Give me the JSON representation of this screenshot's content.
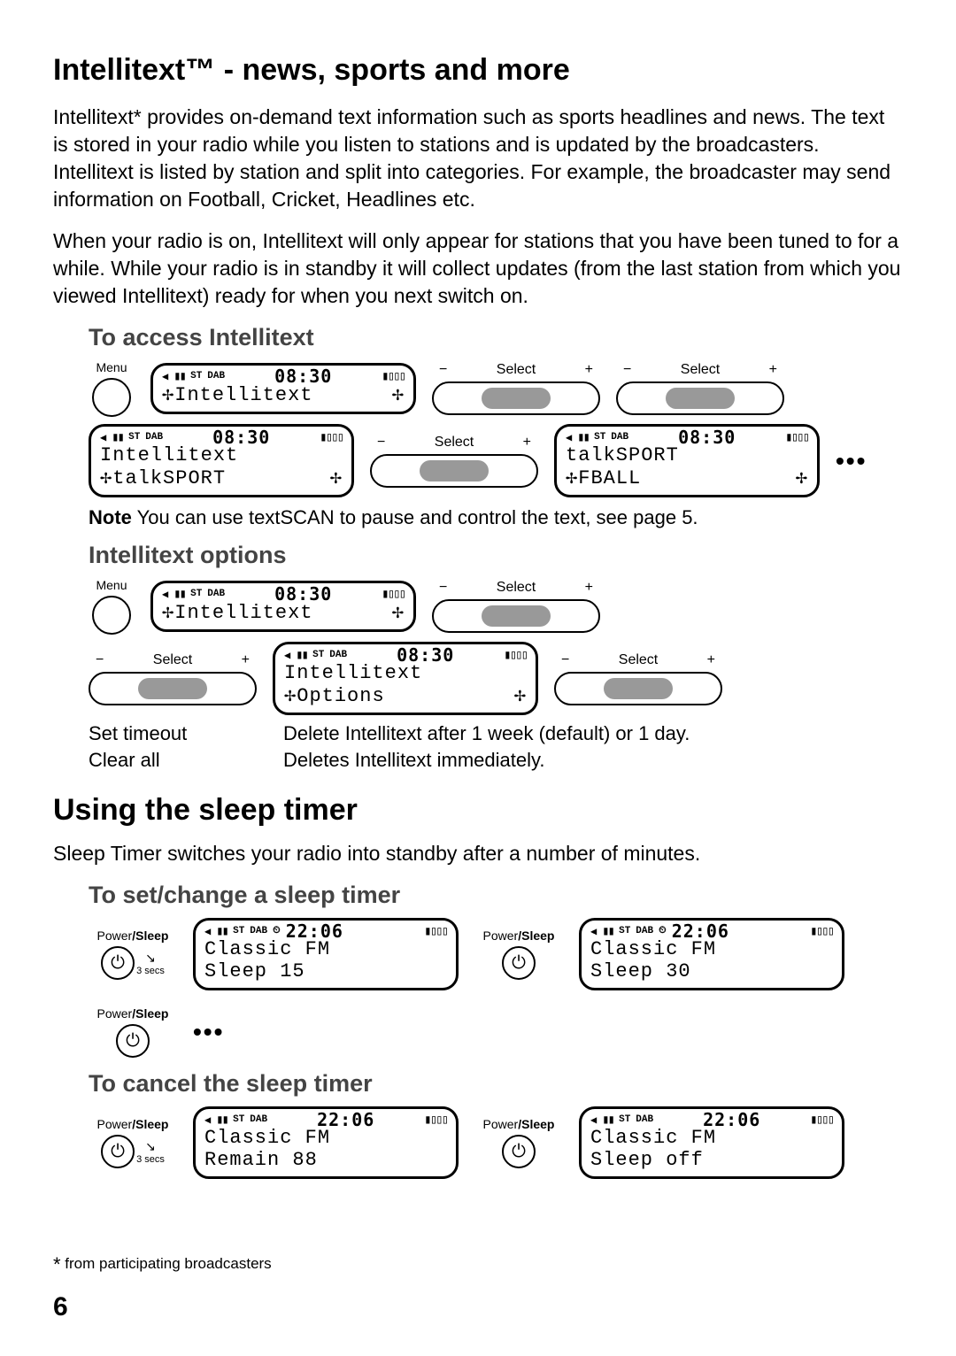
{
  "h1": "Intellitext™ - news, sports and more",
  "p1": "Intellitext* provides on-demand text information such as sports headlines and news. The text is stored in your radio while you listen to stations and is updated by the broadcasters. Intellitext is listed by station and split into categories. For example, the broadcaster may send information on Football, Cricket, Headlines etc.",
  "p2": "When your radio is on, Intellitext will only appear for stations that you have been tuned to for a while. While your radio is in standby it will collect updates (from the last station from which you viewed Intellitext) ready for when you next switch on.",
  "h3_access": "To access Intellitext",
  "labels": {
    "menu": "Menu",
    "select": "Select",
    "minus": "−",
    "plus": "+",
    "st": "ST",
    "dab": "DAB",
    "power_sleep_pre": "Power",
    "power_sleep_suf": "/Sleep",
    "secs3": "3 secs",
    "ellipsis": "•••"
  },
  "lcd": {
    "t0830": "08:30",
    "intellitext": "✢Intellitext",
    "intellitext_plain": "Intellitext",
    "talksport": "✢talkSPORT",
    "talksport_plain": "talkSPORT",
    "fball": "✢FBALL",
    "options": "✢Options",
    "t2206": "22:06",
    "classicfm": "Classic FM",
    "sleep15": "Sleep 15",
    "sleep30": "Sleep 30",
    "remain88": "Remain 88",
    "sleepoff": "Sleep off"
  },
  "note_b": "Note",
  "note_t": " You can use textSCAN to pause and control the text, see page 5.",
  "h3_opts": "Intellitext options",
  "opt_rows": {
    "k1": "Set timeout",
    "v1": "Delete Intellitext after 1 week (default) or 1 day.",
    "k2": "Clear all",
    "v2": "Deletes Intellitext immediately."
  },
  "h2_sleep": "Using the sleep timer",
  "p3": "Sleep Timer switches your radio into standby after a number of minutes.",
  "h3_set": "To set/change a sleep timer",
  "h3_cancel": "To cancel the sleep timer",
  "footnote": "from participating broadcasters",
  "ast": "*",
  "page": "6",
  "timer_icon": "⏲"
}
